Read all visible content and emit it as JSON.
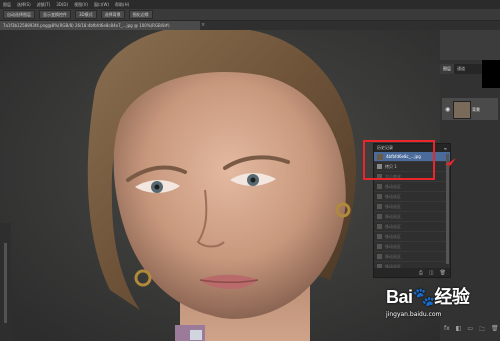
{
  "menubar": {
    "items": [
      "图层",
      "选择(S)",
      "滤镜(T)",
      "3D(D)",
      "视图(V)",
      "窗口(W)",
      "帮助(H)"
    ]
  },
  "options": {
    "chips": [
      "自动选择图层",
      "显示变换控件",
      "3D模式",
      "选择背景",
      "细化边缘"
    ]
  },
  "document": {
    "tab_title": "7a1f3b1258893f4.png@8%(RGB/8) 26/18:4bfbfd6e8c84e7_...jpg @ 100%(RGB/8#)",
    "close_glyph": "×"
  },
  "layers_panel": {
    "tabs": [
      "图层",
      "通道"
    ],
    "layer_name": "背景",
    "eye": "◉",
    "bottom_icons": [
      "fx",
      "◧",
      "▭",
      "🗀",
      "🗑"
    ]
  },
  "history_panel": {
    "title": "历史记录",
    "rows": [
      {
        "text": "4bfbfd6e8c_...jpg",
        "state": "sel"
      },
      {
        "text": "拷贝 1",
        "state": "normal"
      },
      {
        "text": "大小变化",
        "state": "dim"
      },
      {
        "text": "移动选区",
        "state": "dim"
      },
      {
        "text": "移动选区",
        "state": "dim"
      },
      {
        "text": "移动选区",
        "state": "dim"
      },
      {
        "text": "移动选区",
        "state": "dim"
      },
      {
        "text": "移动选区",
        "state": "dim"
      },
      {
        "text": "移动选区",
        "state": "dim"
      },
      {
        "text": "移动选区",
        "state": "dim"
      },
      {
        "text": "移动选区",
        "state": "dim"
      },
      {
        "text": "移动选区",
        "state": "dim"
      }
    ],
    "footer_icons": [
      "⎙",
      "◫",
      "🗑"
    ]
  },
  "watermark": {
    "logo": "Bai🐾经验",
    "url": "jingyan.baidu.com"
  },
  "colors": {
    "highlight": "#e8262b",
    "selection": "#4b6b9a"
  }
}
